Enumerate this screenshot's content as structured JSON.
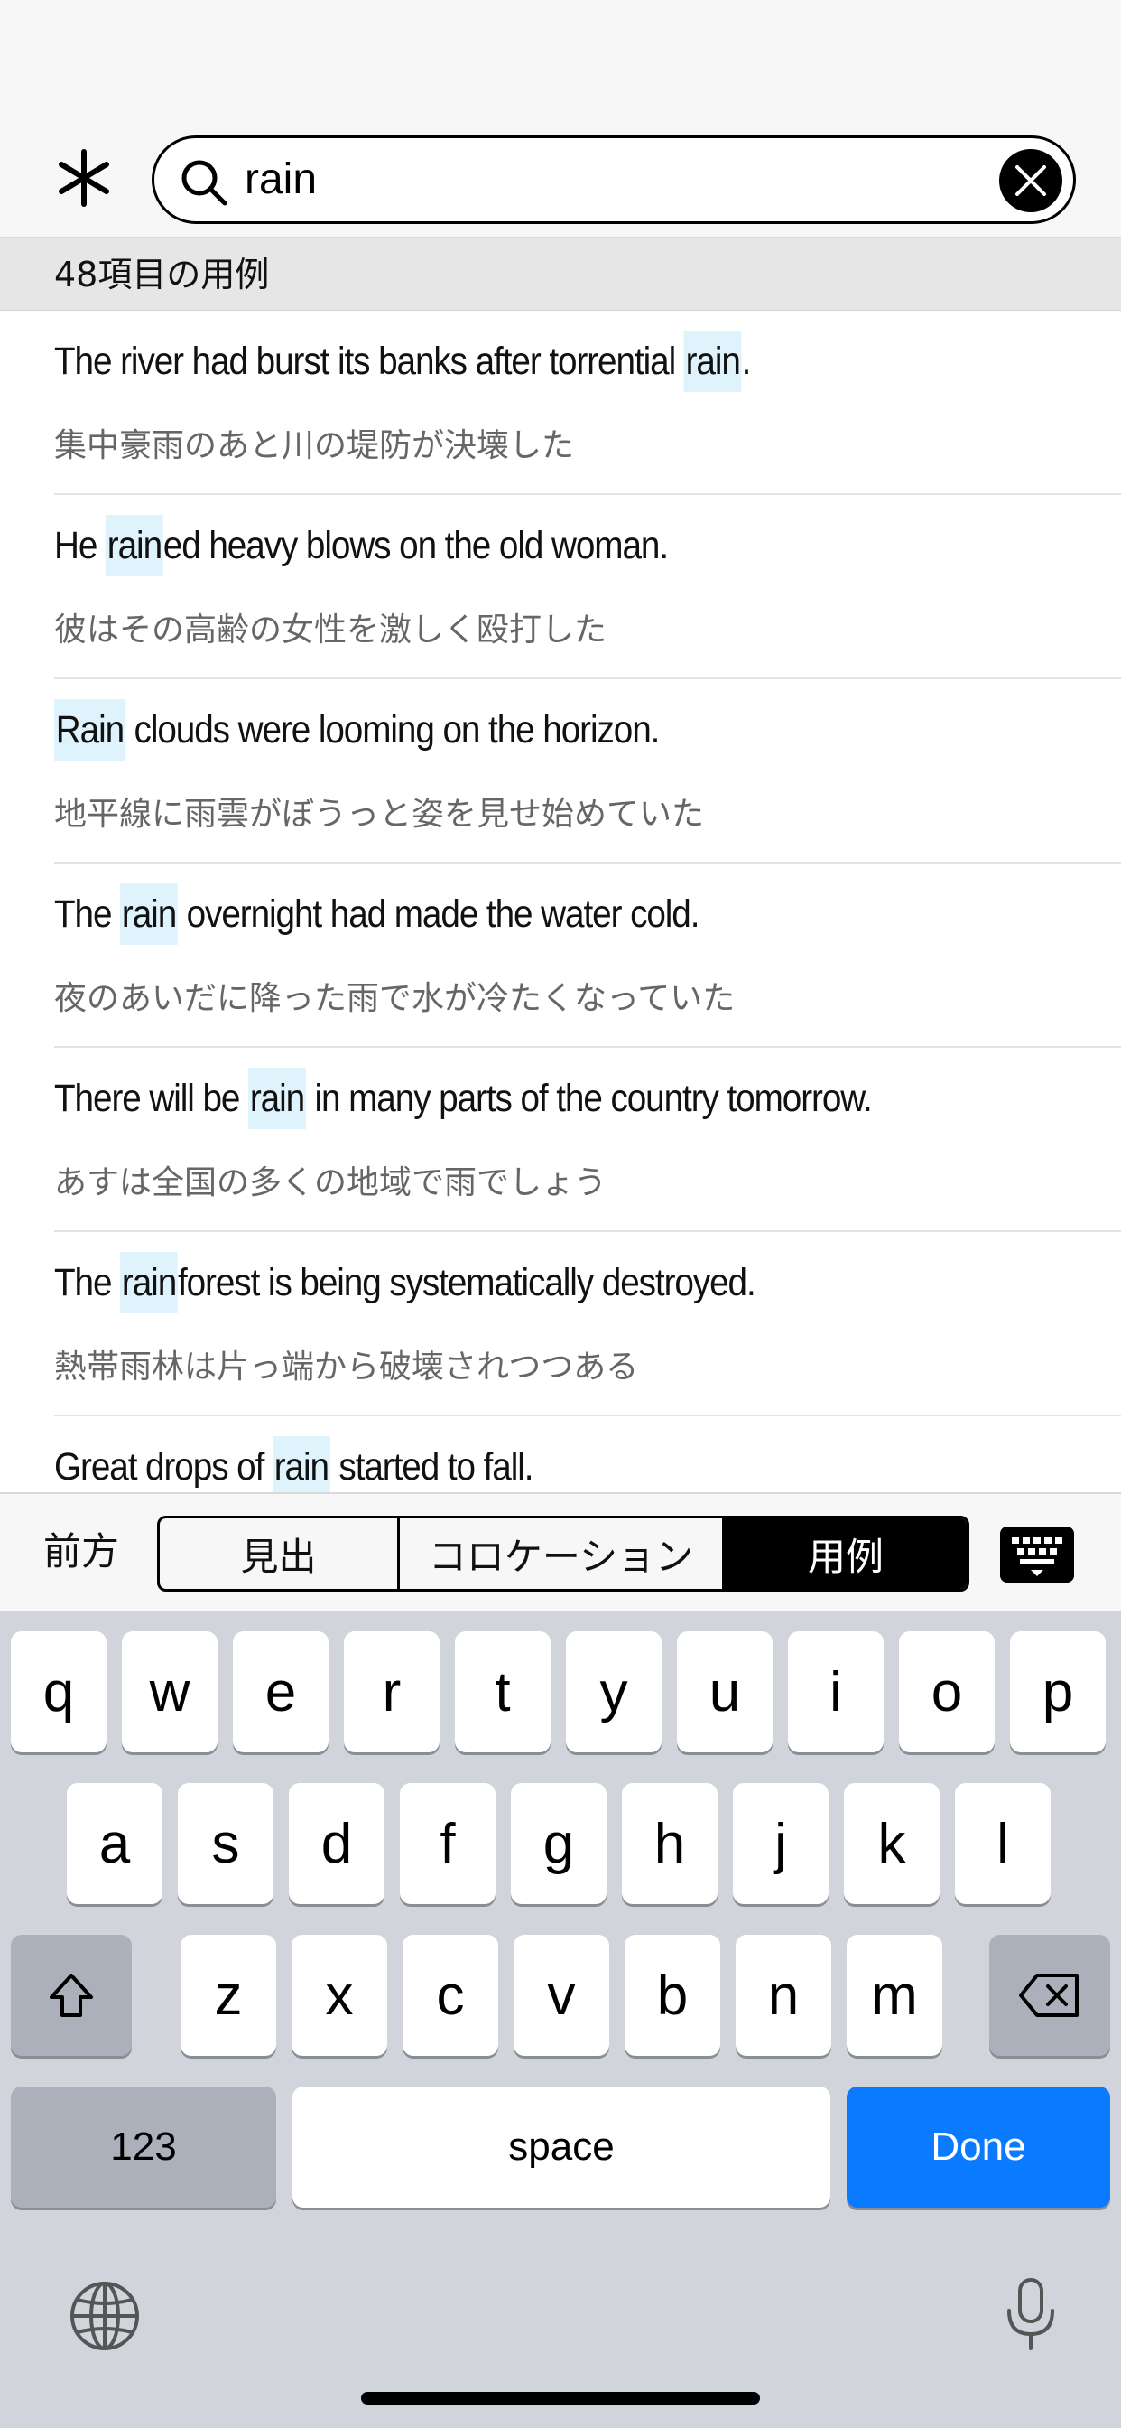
{
  "search": {
    "query": "rain"
  },
  "results_header": "48項目の用例",
  "results": [
    {
      "parts": [
        "The river had burst its banks after torrential ",
        "rain",
        "."
      ],
      "ja": "集中豪雨のあと川の堤防が決壊した"
    },
    {
      "parts": [
        "He ",
        "rain",
        "ed heavy blows on the old woman."
      ],
      "ja": "彼はその高齢の女性を激しく殴打した"
    },
    {
      "parts": [
        "",
        "Rain",
        " clouds were looming on the horizon."
      ],
      "ja": "地平線に雨雲がぼうっと姿を見せ始めていた"
    },
    {
      "parts": [
        "The ",
        "rain",
        " overnight had made the water cold."
      ],
      "ja": "夜のあいだに降った雨で水が冷たくなっていた"
    },
    {
      "parts": [
        "There will be ",
        "rain",
        " in many parts of the country tomorrow."
      ],
      "ja": "あすは全国の多くの地域で雨でしょう"
    },
    {
      "parts": [
        "The ",
        "rain",
        "forest is being systematically destroyed."
      ],
      "ja": "熱帯雨林は片っ端から破壊されつつある"
    },
    {
      "parts": [
        "Great drops of ",
        "rain",
        " started to fall."
      ],
      "ja": ""
    }
  ],
  "filter": {
    "prefix_label": "前方",
    "segments": [
      "見出",
      "コロケーション",
      "用例"
    ],
    "selected": "用例"
  },
  "keyboard": {
    "row1": [
      "q",
      "w",
      "e",
      "r",
      "t",
      "y",
      "u",
      "i",
      "o",
      "p"
    ],
    "row2": [
      "a",
      "s",
      "d",
      "f",
      "g",
      "h",
      "j",
      "k",
      "l"
    ],
    "row3": [
      "z",
      "x",
      "c",
      "v",
      "b",
      "n",
      "m"
    ],
    "numbers_label": "123",
    "space_label": "space",
    "done_label": "Done"
  },
  "colors": {
    "highlight": "#dff3fc",
    "done_key": "#0a7aff"
  },
  "icons": [
    "asterisk-icon",
    "search-icon",
    "clear-icon",
    "keyboard-icon",
    "shift-icon",
    "delete-icon",
    "globe-icon",
    "microphone-icon"
  ]
}
